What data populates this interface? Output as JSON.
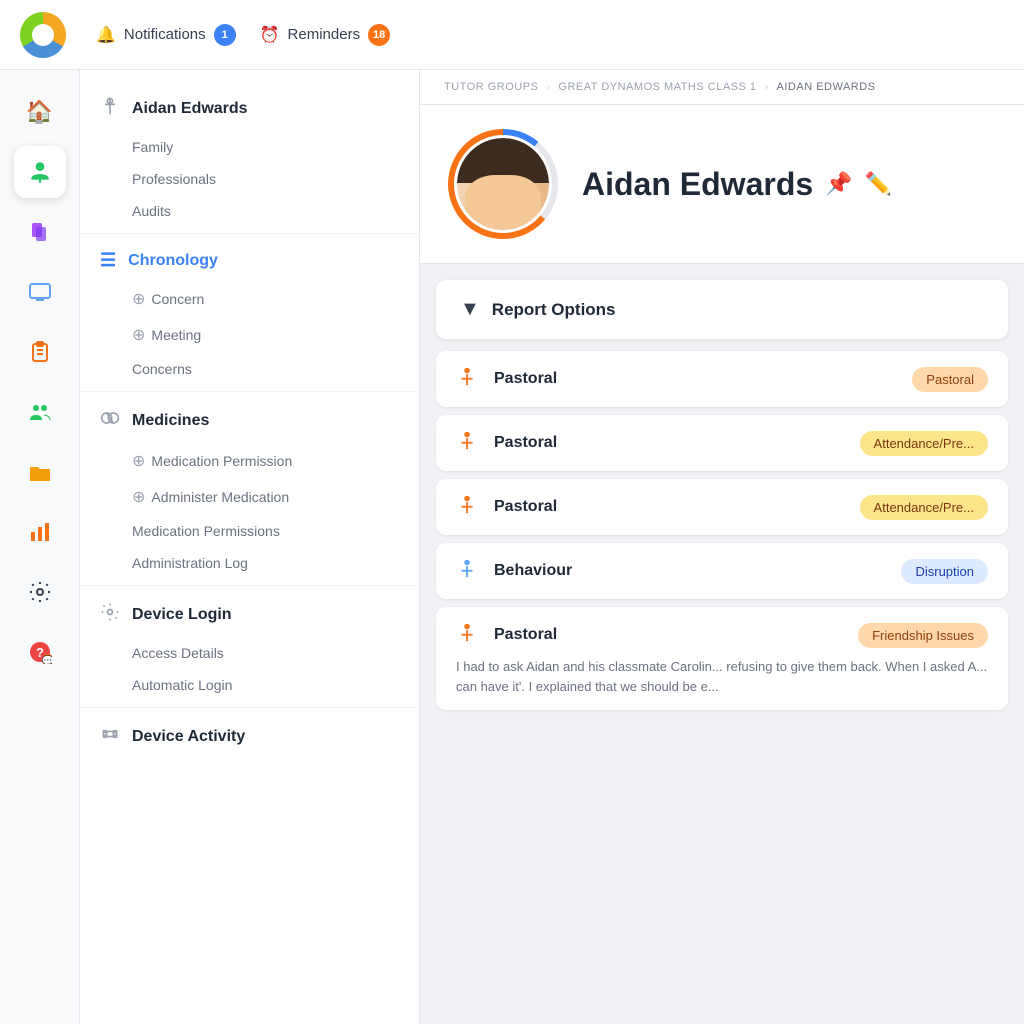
{
  "header": {
    "notifications_label": "Notifications",
    "notifications_count": "1",
    "reminders_label": "Reminders",
    "reminders_count": "18"
  },
  "icon_bar": {
    "items": [
      {
        "name": "home-icon",
        "symbol": "🏠",
        "active": false
      },
      {
        "name": "person-icon",
        "symbol": "🧍",
        "active": true
      },
      {
        "name": "documents-icon",
        "symbol": "📋",
        "active": false
      },
      {
        "name": "monitor-icon",
        "symbol": "🖥",
        "active": false
      },
      {
        "name": "clipboard-icon",
        "symbol": "📝",
        "active": false
      },
      {
        "name": "group-icon",
        "symbol": "👥",
        "active": false
      },
      {
        "name": "folder-icon",
        "symbol": "📁",
        "active": false
      },
      {
        "name": "chart-icon",
        "symbol": "📊",
        "active": false
      },
      {
        "name": "settings-icon",
        "symbol": "⚙️",
        "active": false
      },
      {
        "name": "help-icon",
        "symbol": "❓",
        "active": false
      }
    ]
  },
  "sidebar": {
    "student_name": "Aidan Edwards",
    "student_icon": "🧍",
    "sub_items_student": [
      "Family",
      "Professionals",
      "Audits"
    ],
    "chronology_label": "Chronology",
    "chronology_icon": "☰",
    "chronology_actions": [
      "Concern",
      "Meeting"
    ],
    "chronology_sub": [
      "Concerns"
    ],
    "medicines_label": "Medicines",
    "medicines_icon": "💊",
    "medicines_actions": [
      "Medication Permission",
      "Administer Medication"
    ],
    "medicines_sub": [
      "Medication Permissions",
      "Administration Log"
    ],
    "device_login_label": "Device Login",
    "device_login_icon": "⚙️",
    "device_login_sub": [
      "Access Details",
      "Automatic Login"
    ],
    "device_activity_label": "Device Activity",
    "device_activity_icon": "👓"
  },
  "breadcrumb": {
    "items": [
      "Tutor Groups",
      "Great Dynamos Maths Class 1",
      "Aidan Edwards"
    ]
  },
  "profile": {
    "name": "Aidan Edwards",
    "pin_label": "📌",
    "edit_label": "✏️"
  },
  "report_options": {
    "label": "Report Options"
  },
  "timeline_entries": [
    {
      "category": "Pastoral",
      "type_icon": "orange",
      "tag": "Pastoral",
      "tag_class": "tag-pastoral"
    },
    {
      "category": "Pastoral",
      "type_icon": "orange",
      "tag": "Attendance/Pre...",
      "tag_class": "tag-attendance"
    },
    {
      "category": "Pastoral",
      "type_icon": "orange",
      "tag": "Attendance/Pre...",
      "tag_class": "tag-attendance"
    },
    {
      "category": "Behaviour",
      "type_icon": "blue",
      "tag": "Disruption",
      "tag_class": "tag-behaviour"
    },
    {
      "category": "Pastoral",
      "type_icon": "orange",
      "tag": "Friendship Issues",
      "tag_class": "tag-friendship",
      "text": "I had to ask Aidan and his classmate Carolin... refusing to give them back. When I asked A... can have it'. I explained that we should be e..."
    }
  ]
}
